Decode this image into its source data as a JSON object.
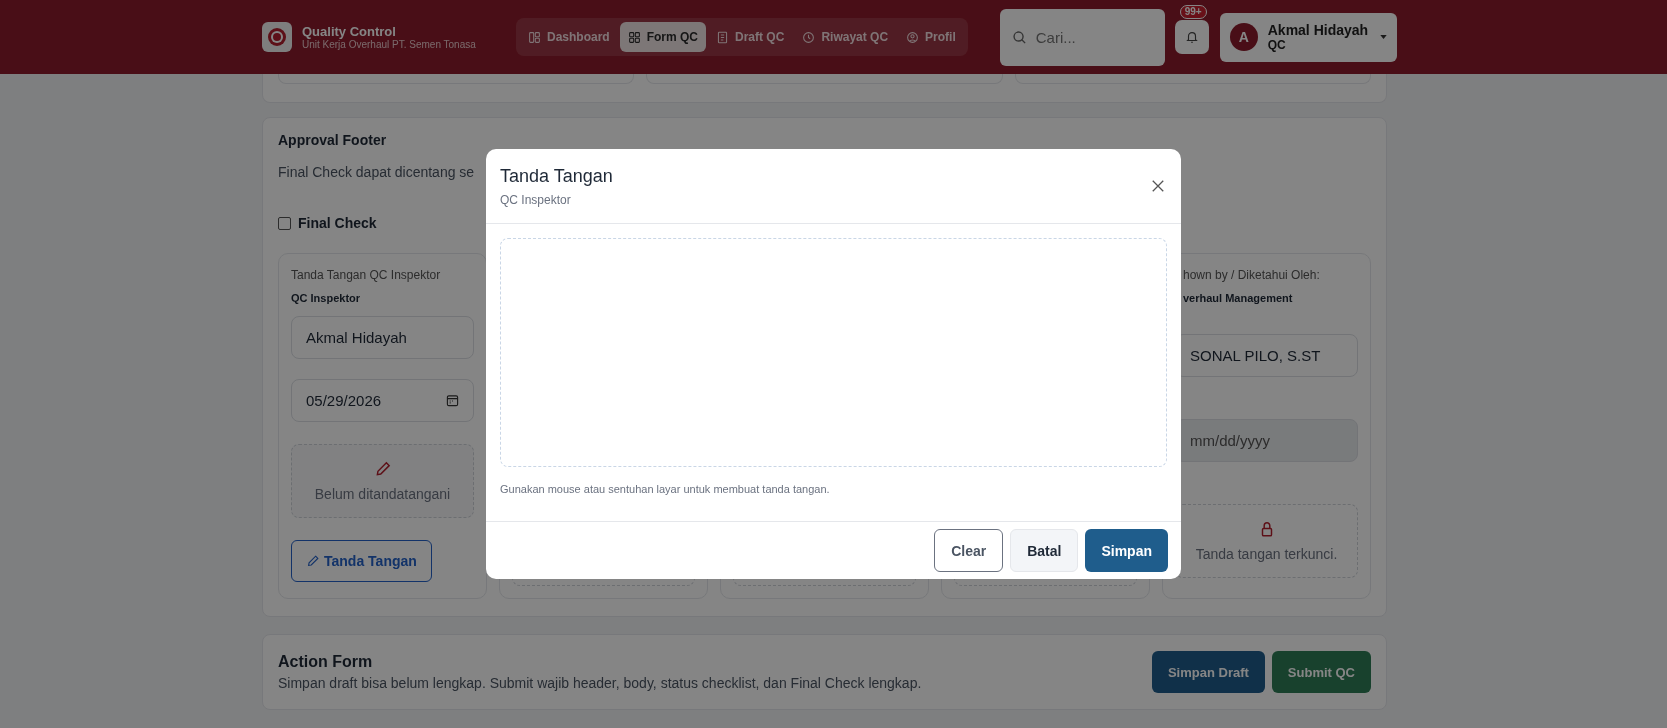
{
  "header": {
    "app_title": "Quality Control",
    "app_subtitle": "Unit Kerja Overhaul PT. Semen Tonasa",
    "tabs": [
      {
        "label": "Dashboard",
        "kind": "layout",
        "selected": false
      },
      {
        "label": "Form QC",
        "kind": "grid",
        "selected": true
      },
      {
        "label": "Draft QC",
        "kind": "doc",
        "selected": false
      },
      {
        "label": "Riwayat QC",
        "kind": "clock",
        "selected": false
      },
      {
        "label": "Profil",
        "kind": "user",
        "selected": false
      }
    ],
    "search": {
      "placeholder": "Cari..."
    },
    "notifications": {
      "badge": "99+"
    },
    "user": {
      "initial": "A",
      "name": "Akmal Hidayah",
      "role": "QC"
    }
  },
  "approval": {
    "title": "Approval Footer",
    "note": "Final Check dapat dicentang se",
    "final_check": {
      "label": "Final Check",
      "checked": false
    },
    "signers": [
      {
        "kind": "open",
        "label": "Tanda Tangan QC Inspektor",
        "role": "QC Inspektor",
        "name": "Akmal Hidayah",
        "date": "05/29/2026",
        "signature_status": "Belum ditandatangani",
        "sign_button": "Tanda Tangan"
      },
      {
        "kind": "covered"
      },
      {
        "kind": "covered"
      },
      {
        "kind": "covered"
      },
      {
        "kind": "locked",
        "label": "hown by / Diketahui Oleh:",
        "role": "verhaul Management",
        "name": "SONAL PILO, S.ST",
        "date_placeholder": "mm/dd/yyyy",
        "signature_status": "Tanda tangan terkunci."
      }
    ]
  },
  "action_form": {
    "title": "Action Form",
    "description": "Simpan draft bisa belum lengkap. Submit wajib header, body, status checklist, dan Final Check lengkap.",
    "buttons": [
      {
        "label": "Simpan Draft",
        "kind": "primary"
      },
      {
        "label": "Submit QC",
        "kind": "success"
      }
    ]
  },
  "modal": {
    "title": "Tanda Tangan",
    "subtitle": "QC Inspektor",
    "hint": "Gunakan mouse atau sentuhan layar untuk membuat tanda tangan.",
    "buttons": [
      {
        "label": "Clear",
        "kind": "outline"
      },
      {
        "label": "Batal",
        "kind": "light"
      },
      {
        "label": "Simpan",
        "kind": "primary"
      }
    ]
  }
}
